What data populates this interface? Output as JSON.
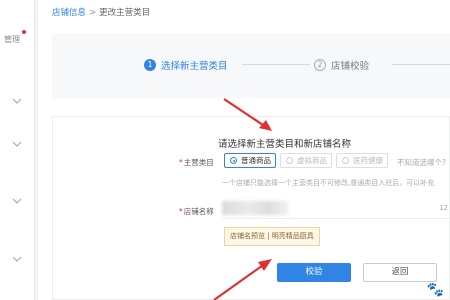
{
  "breadcrumb": {
    "link": "店铺信息",
    "separator": ">",
    "current": "更改主营类目"
  },
  "sidebar": {
    "item_label": "管理"
  },
  "steps": [
    {
      "num": "1",
      "label": "选择新主营类目",
      "state": "active"
    },
    {
      "num": "2",
      "label": "店铺校验",
      "state": "todo"
    }
  ],
  "form": {
    "title": "请选择新主营类目和新店铺名称",
    "category_label": "主营类目",
    "category_options": [
      "普通商品",
      "虚拟商品",
      "医药健康"
    ],
    "category_selected": "普通商品",
    "category_side_hint": "不知道选哪个?",
    "category_hint": "一个店铺只能选择一个主营类目不可修改,普通类目入驻后，可以补充",
    "name_label": "店铺名称",
    "name_counter": "12",
    "preview_tag": "店铺名预览 | 明亮精品厨具"
  },
  "buttons": {
    "submit": "校验",
    "back": "返回"
  },
  "colors": {
    "accent": "#2f84e6",
    "arrow": "#e03030",
    "tag_bg": "#fef6e6"
  }
}
